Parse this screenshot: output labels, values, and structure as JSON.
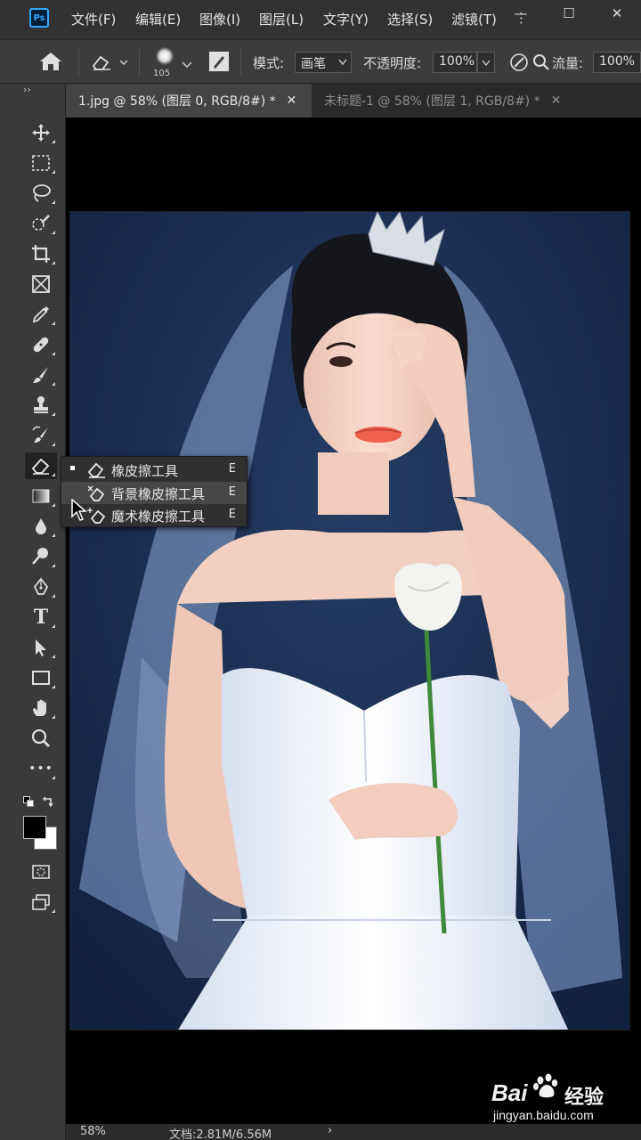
{
  "app": {
    "logo": "Ps"
  },
  "menu": [
    "文件(F)",
    "编辑(E)",
    "图像(I)",
    "图层(L)",
    "文字(Y)",
    "选择(S)",
    "滤镜(T)",
    "⋮"
  ],
  "window_controls": {
    "minimize": "—",
    "maximize": "☐",
    "close": "✕"
  },
  "options": {
    "brush_size": "105",
    "mode_label": "模式:",
    "mode_value": "画笔",
    "opacity_label": "不透明度:",
    "opacity_value": "100%",
    "flow_label": "流量:",
    "flow_value": "100%"
  },
  "toolbar_collapse": "››",
  "tabs": [
    {
      "label": "1.jpg @ 58% (图层 0, RGB/8#) *",
      "close": "✕"
    },
    {
      "label": "未标题-1 @ 58% (图层 1, RGB/8#) *",
      "close": "✕"
    }
  ],
  "tools": [
    "move-tool",
    "marquee-tool",
    "lasso-tool",
    "quick-select-tool",
    "crop-tool",
    "frame-tool",
    "eyedropper-tool",
    "healing-tool",
    "brush-tool",
    "stamp-tool",
    "history-brush-tool",
    "eraser-tool",
    "gradient-tool",
    "blur-tool",
    "dodge-tool",
    "pen-tool",
    "type-tool",
    "path-select-tool",
    "rectangle-tool",
    "hand-tool",
    "zoom-tool",
    "more-tools"
  ],
  "type_tool_glyph": "T",
  "more_glyph": "•••",
  "flyout": [
    {
      "label": "橡皮擦工具",
      "key": "E"
    },
    {
      "label": "背景橡皮擦工具",
      "key": "E"
    },
    {
      "label": "魔术橡皮擦工具",
      "key": "E"
    }
  ],
  "status": {
    "zoom": "58%",
    "doc": "文档:2.81M/6.56M",
    "arrow": "›"
  },
  "watermark": {
    "brand": "Bai",
    "brand2": "经验",
    "url": "jingyan.baidu.com"
  },
  "colors": {
    "accent": "#31a8ff",
    "foreground": "#000000",
    "background": "#ffffff",
    "photo_bg": "#17294a"
  }
}
